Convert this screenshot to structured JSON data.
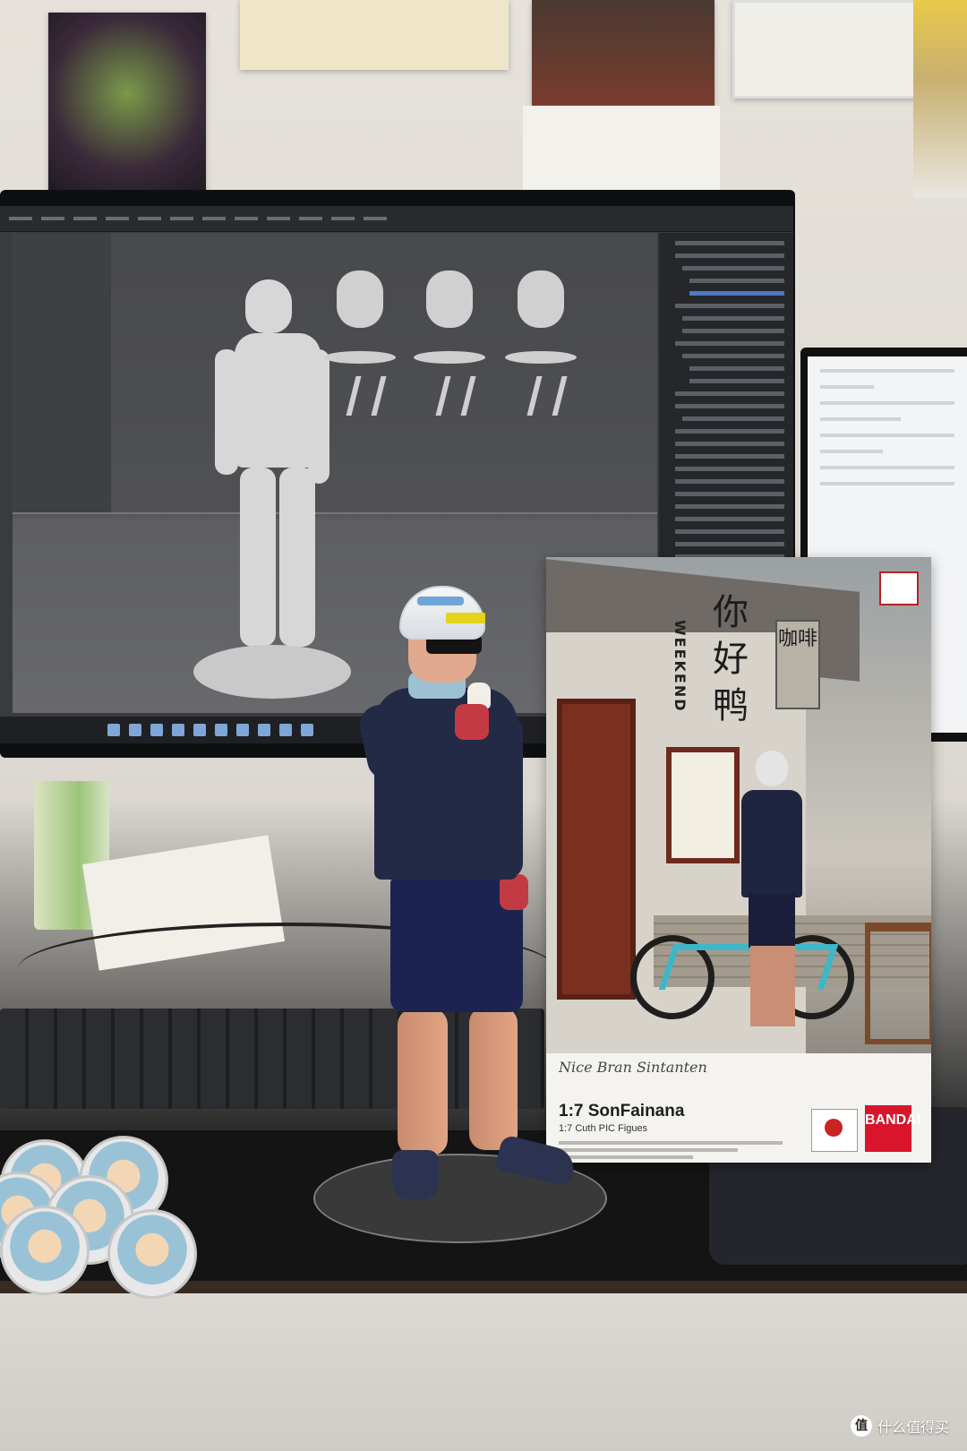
{
  "box": {
    "sign_chinese": "你好鸭",
    "sign_english": "WEEKEND",
    "side_sign": "咖啡",
    "script_line": "Nice Bran Sintanten",
    "script_subline": "",
    "title": "1:7 SonFainana",
    "subtitle": "1:7 Cuth PIC Figues",
    "brand": "BANDAI"
  },
  "watermark": {
    "icon_glyph": "值",
    "text": "什么值得买"
  },
  "colors": {
    "jersey": "#232a45",
    "gloves": "#c43a44",
    "bandai_red": "#d8152b",
    "bike_frame": "#3fb6c8"
  }
}
